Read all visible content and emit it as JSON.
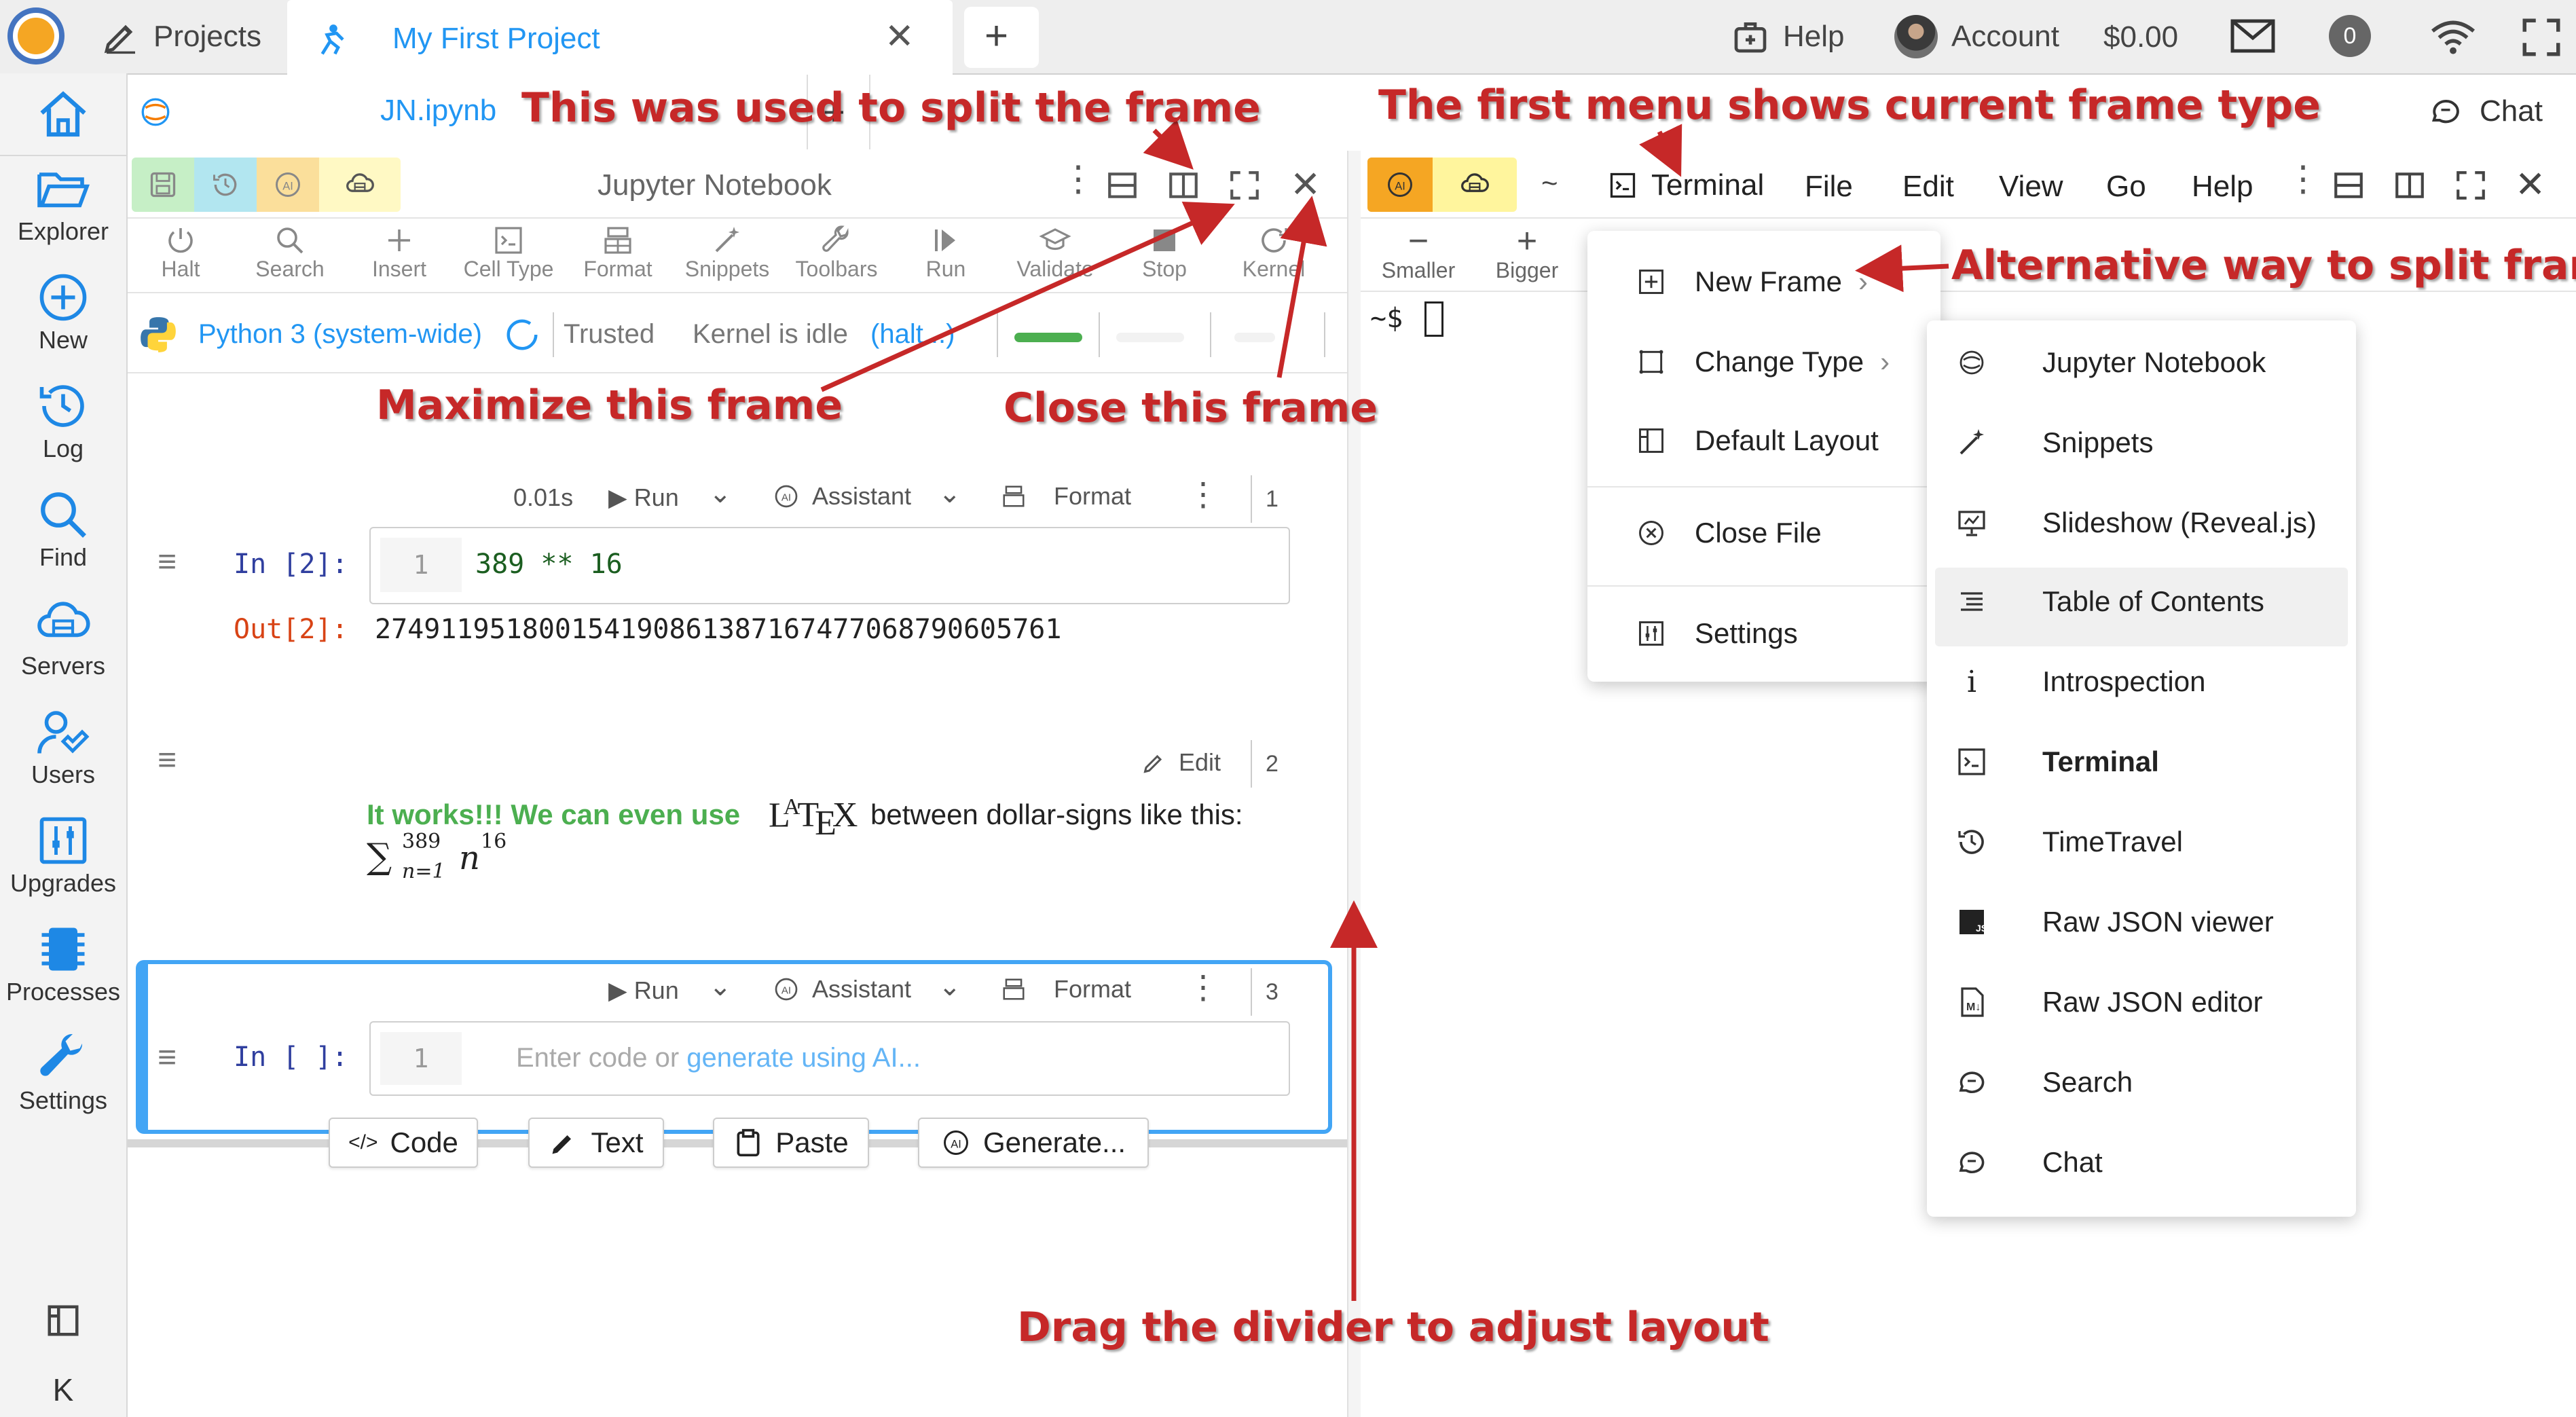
{
  "topbar": {
    "projects_label": "Projects",
    "project_tab_label": "My First Project",
    "help_label": "Help",
    "account_label": "Account",
    "balance": "$0.00",
    "notification_count": "0"
  },
  "filetab": {
    "filename": "JN.ipynb",
    "chat_label": "Chat"
  },
  "rail": {
    "items": [
      {
        "label": "Explorer"
      },
      {
        "label": "New"
      },
      {
        "label": "Log"
      },
      {
        "label": "Find"
      },
      {
        "label": "Servers"
      },
      {
        "label": "Users"
      },
      {
        "label": "Upgrades"
      },
      {
        "label": "Processes"
      },
      {
        "label": "Settings"
      }
    ],
    "collapse_glyph": "K"
  },
  "left_frame": {
    "title": "Jupyter Notebook",
    "toolbar": [
      "Halt",
      "Search",
      "Insert",
      "Cell Type",
      "Format",
      "Snippets",
      "Toolbars",
      "Run",
      "Validate",
      "Stop",
      "Kernel"
    ],
    "kernel_name": "Python 3 (system-wide)",
    "trusted": "Trusted",
    "kernel_status": "Kernel is idle",
    "kernel_halt": "(halt...)"
  },
  "cells": {
    "cell1": {
      "time": "0.01s",
      "run": "Run",
      "assistant": "Assistant",
      "format": "Format",
      "number": "1",
      "in_prompt": "In [2]:",
      "line_no": "1",
      "code": "389 ** 16",
      "out_prompt": "Out[2]:",
      "output": "274911951800154190861387167477068790605761"
    },
    "cell2": {
      "edit": "Edit",
      "number": "2",
      "text_green": "It works!!! We can even use",
      "latex_logo": "LATEX",
      "text_rest": "between dollar-signs like this:",
      "math_sigma": "∑",
      "math_upper": "389",
      "math_lower": "n=1",
      "math_term": "n",
      "math_exp": "16"
    },
    "cell3": {
      "run": "Run",
      "assistant": "Assistant",
      "format": "Format",
      "number": "3",
      "in_prompt": "In [ ]:",
      "line_no": "1",
      "placeholder_a": "Enter code or ",
      "placeholder_link": "generate using AI..."
    },
    "add_buttons": [
      "Code",
      "Text",
      "Paste",
      "Generate..."
    ]
  },
  "right_frame": {
    "tilde": "~",
    "frame_type": "Terminal",
    "menus": [
      "File",
      "Edit",
      "View",
      "Go",
      "Help"
    ],
    "smaller": "Smaller",
    "bigger": "Bigger",
    "prompt": "~$"
  },
  "frame_menu": {
    "items": [
      "New Frame",
      "Change Type",
      "Default Layout",
      "Close File",
      "Settings"
    ]
  },
  "type_menu": {
    "items": [
      "Jupyter Notebook",
      "Snippets",
      "Slideshow (Reveal.js)",
      "Table of Contents",
      "Introspection",
      "Terminal",
      "TimeTravel",
      "Raw JSON viewer",
      "Raw JSON editor",
      "Search",
      "Chat"
    ]
  },
  "annotations": {
    "split": "This was used to split the frame",
    "first_menu": "The first menu shows current frame type",
    "alt_split": "Alternative way to split frame",
    "maximize": "Maximize this frame",
    "close": "Close this frame",
    "divider": "Drag the divider to adjust layout"
  },
  "colors": {
    "accent_blue": "#2196f3",
    "annotation_red": "#c62828",
    "green_text": "#4caf50",
    "prompt_blue": "#303f9f",
    "prompt_red": "#d84315"
  }
}
